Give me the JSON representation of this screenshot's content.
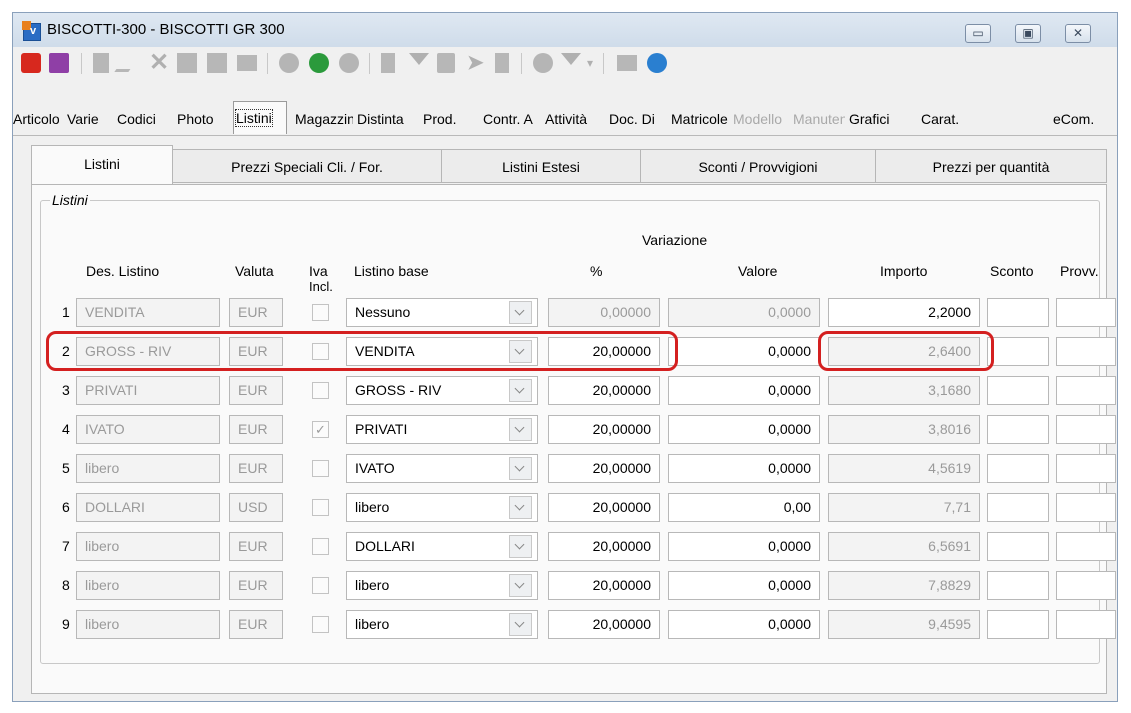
{
  "window": {
    "title": "BISCOTTI-300 - BISCOTTI GR 300",
    "buttons": {
      "minimize": "▭",
      "maximize": "▣",
      "close": "✕"
    }
  },
  "toolbar": {
    "icons": [
      "power-icon",
      "save-icon",
      "document-icon",
      "edit-icon",
      "delete-icon",
      "copy-icon",
      "paste-icon",
      "print-icon",
      "circle-icon",
      "phone-icon",
      "circle-icon",
      "clipboard-icon",
      "filter-icon",
      "import-icon",
      "next-icon",
      "file-icon",
      "record-icon",
      "filter-dropdown-icon",
      "chart-icon",
      "globe-icon"
    ],
    "colors": {
      "power": "#d7281e",
      "save": "#8f3fa6",
      "phone": "#2b9a3c",
      "globe": "#2a7fd0"
    }
  },
  "main_tabs": [
    {
      "label": "Articolo",
      "state": "normal"
    },
    {
      "label": "Varie",
      "state": "normal"
    },
    {
      "label": "Codici",
      "state": "normal"
    },
    {
      "label": "Photo",
      "state": "normal"
    },
    {
      "label": "Listini",
      "state": "active"
    },
    {
      "label": "Magazzino",
      "state": "normal"
    },
    {
      "label": "Distinta",
      "state": "normal"
    },
    {
      "label": "Prod.",
      "state": "normal"
    },
    {
      "label": "Contr. A",
      "state": "normal"
    },
    {
      "label": "Attività",
      "state": "normal"
    },
    {
      "label": "Doc. Di",
      "state": "normal"
    },
    {
      "label": "Matricole",
      "state": "normal"
    },
    {
      "label": "Modello",
      "state": "disabled"
    },
    {
      "label": "Manutenzione",
      "state": "disabled"
    },
    {
      "label": "Grafici",
      "state": "normal"
    },
    {
      "label": "Carat.",
      "state": "normal"
    },
    {
      "label": "eCom.",
      "state": "normal"
    }
  ],
  "sub_tabs": [
    {
      "label": "Listini"
    },
    {
      "label": "Prezzi Speciali Cli. / For."
    },
    {
      "label": "Listini Estesi"
    },
    {
      "label": "Sconti / Provvigioni"
    },
    {
      "label": "Prezzi per quantità"
    }
  ],
  "group_title": "Listini",
  "headers": {
    "variazione": "Variazione",
    "des_listino": "Des. Listino",
    "valuta": "Valuta",
    "iva": "Iva",
    "incl": "Incl.",
    "listino_base": "Listino base",
    "percent": "%",
    "valore": "Valore",
    "importo": "Importo",
    "sconto": "Sconto",
    "provv": "Provv."
  },
  "rows": [
    {
      "n": "1",
      "des": "VENDITA",
      "valuta": "EUR",
      "iva": false,
      "base": "Nessuno",
      "pct": "0,00000",
      "valore": "0,0000",
      "importo": "2,2000",
      "editable": false,
      "importo_editable": true
    },
    {
      "n": "2",
      "des": "GROSS - RIV",
      "valuta": "EUR",
      "iva": false,
      "base": "VENDITA",
      "pct": "20,00000",
      "valore": "0,0000",
      "importo": "2,6400",
      "editable": true,
      "importo_editable": false
    },
    {
      "n": "3",
      "des": "PRIVATI",
      "valuta": "EUR",
      "iva": false,
      "base": "GROSS - RIV",
      "pct": "20,00000",
      "valore": "0,0000",
      "importo": "3,1680",
      "editable": true,
      "importo_editable": false
    },
    {
      "n": "4",
      "des": "IVATO",
      "valuta": "EUR",
      "iva": true,
      "base": "PRIVATI",
      "pct": "20,00000",
      "valore": "0,0000",
      "importo": "3,8016",
      "editable": true,
      "importo_editable": false
    },
    {
      "n": "5",
      "des": "libero",
      "valuta": "EUR",
      "iva": false,
      "base": "IVATO",
      "pct": "20,00000",
      "valore": "0,0000",
      "importo": "4,5619",
      "editable": true,
      "importo_editable": false
    },
    {
      "n": "6",
      "des": "DOLLARI",
      "valuta": "USD",
      "iva": false,
      "base": "libero",
      "pct": "20,00000",
      "valore": "0,00",
      "importo": "7,71",
      "editable": true,
      "importo_editable": false
    },
    {
      "n": "7",
      "des": "libero",
      "valuta": "EUR",
      "iva": false,
      "base": "DOLLARI",
      "pct": "20,00000",
      "valore": "0,0000",
      "importo": "6,5691",
      "editable": true,
      "importo_editable": false
    },
    {
      "n": "8",
      "des": "libero",
      "valuta": "EUR",
      "iva": false,
      "base": "libero",
      "pct": "20,00000",
      "valore": "0,0000",
      "importo": "7,8829",
      "editable": true,
      "importo_editable": false
    },
    {
      "n": "9",
      "des": "libero",
      "valuta": "EUR",
      "iva": false,
      "base": "libero",
      "pct": "20,00000",
      "valore": "0,0000",
      "importo": "9,4595",
      "editable": true,
      "importo_editable": false
    }
  ],
  "highlight_color": "#d42020"
}
